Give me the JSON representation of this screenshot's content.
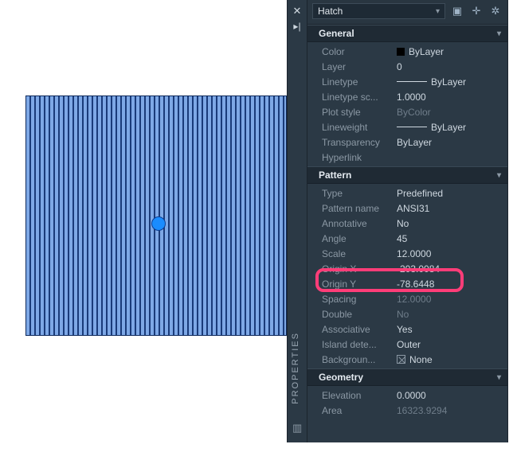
{
  "palette_title": "PROPERTIES",
  "object_type": "Hatch",
  "sections": {
    "general": {
      "title": "General",
      "color_label": "Color",
      "color_value": "ByLayer",
      "layer_label": "Layer",
      "layer_value": "0",
      "linetype_label": "Linetype",
      "linetype_value": "ByLayer",
      "ltscale_label": "Linetype sc...",
      "ltscale_value": "1.0000",
      "plotstyle_label": "Plot style",
      "plotstyle_value": "ByColor",
      "lineweight_label": "Lineweight",
      "lineweight_value": "ByLayer",
      "transparency_label": "Transparency",
      "transparency_value": "ByLayer",
      "hyperlink_label": "Hyperlink",
      "hyperlink_value": ""
    },
    "pattern": {
      "title": "Pattern",
      "type_label": "Type",
      "type_value": "Predefined",
      "name_label": "Pattern name",
      "name_value": "ANSI31",
      "annotative_label": "Annotative",
      "annotative_value": "No",
      "angle_label": "Angle",
      "angle_value": "45",
      "scale_label": "Scale",
      "scale_value": "12.0000",
      "originx_label": "Origin X",
      "originx_value": "-203.0084",
      "originy_label": "Origin Y",
      "originy_value": "-78.6448",
      "spacing_label": "Spacing",
      "spacing_value": "12.0000",
      "double_label": "Double",
      "double_value": "No",
      "associative_label": "Associative",
      "associative_value": "Yes",
      "island_label": "Island  dete...",
      "island_value": "Outer",
      "background_label": "Backgroun...",
      "background_value": "None"
    },
    "geometry": {
      "title": "Geometry",
      "elevation_label": "Elevation",
      "elevation_value": "0.0000",
      "area_label": "Area",
      "area_value": "16323.9294"
    }
  }
}
